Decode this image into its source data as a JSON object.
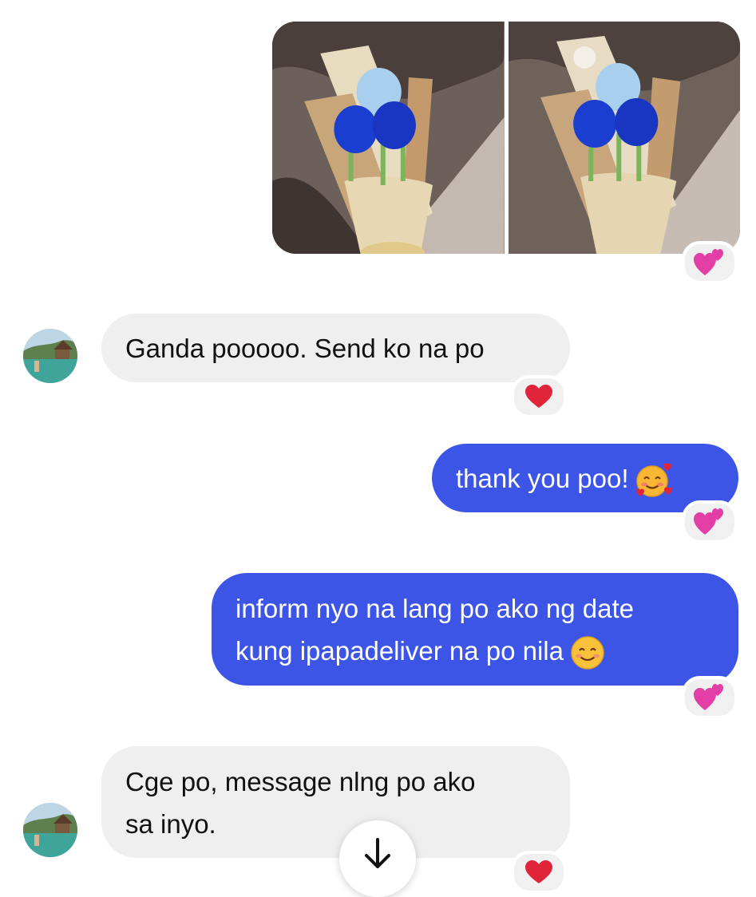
{
  "messages": [
    {
      "type": "photos",
      "reaction": "two-hearts"
    },
    {
      "type": "received",
      "text": "Ganda pooooo. Send ko na po",
      "reaction": "red-heart"
    },
    {
      "type": "sent",
      "text": "thank you poo!",
      "emoji": "smiling-face-with-hearts",
      "reaction": "two-hearts"
    },
    {
      "type": "sent",
      "lines": [
        "inform nyo na lang po ako ng date",
        "kung ipapadeliver na po nila"
      ],
      "emoji": "smiling-face",
      "reaction": "two-hearts"
    },
    {
      "type": "received",
      "lines": [
        "Cge po, message nlng po ako",
        "sa inyo."
      ],
      "reaction": "red-heart"
    }
  ],
  "scroll_button": {
    "icon": "arrow-down-icon"
  },
  "colors": {
    "sent_bubble": "#3d55e6",
    "received_bubble": "#efefef",
    "heart": "#e0243a",
    "pink_heart": "#e33ea6"
  }
}
